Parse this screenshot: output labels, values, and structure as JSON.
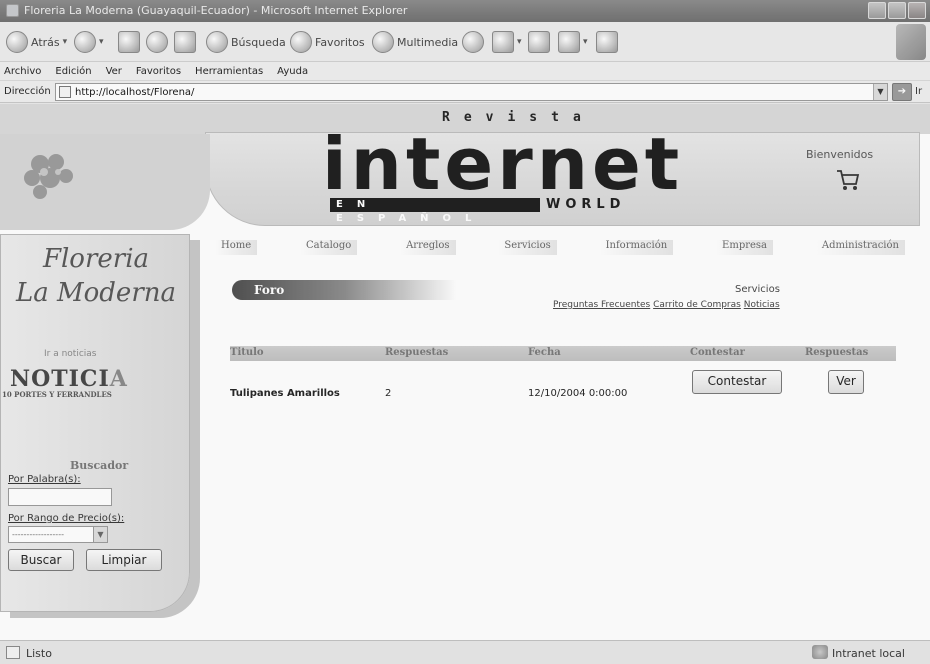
{
  "window": {
    "title": "Floreria La Moderna (Guayaquil-Ecuador) - Microsoft Internet Explorer"
  },
  "toolbar": {
    "back_label": "Atrás",
    "search_label": "Búsqueda",
    "favorites_label": "Favoritos",
    "media_label": "Multimedia"
  },
  "menu": [
    "Archivo",
    "Edición",
    "Ver",
    "Favoritos",
    "Herramientas",
    "Ayuda"
  ],
  "address": {
    "label": "Dirección",
    "url": "http://localhost/Florena/",
    "go_label": "Ir"
  },
  "header": {
    "magazine_top": "Revista",
    "magazine_main": "internet",
    "magazine_lang": "EN ESPAÑOL",
    "magazine_world": "WORLD",
    "welcome": "Bienvenidos"
  },
  "nav": [
    "Home",
    "Catalogo",
    "Arreglos",
    "Servicios",
    "Información",
    "Empresa",
    "Administración"
  ],
  "sidebar": {
    "title_line1": "Floreria",
    "title_line2": "La Moderna",
    "news_link": "Ir a noticias",
    "news_logo_big": "NOTICI",
    "news_logo_a": "A",
    "news_logo_small": "10 PORTES Y FERRANDLES",
    "search_title": "Buscador",
    "keyword_label": "Por Palabra(s):",
    "keyword_value": "",
    "price_label": "Por Rango de Precio(s):",
    "price_value": "------------------",
    "search_button": "Buscar",
    "clear_button": "Limpiar"
  },
  "page": {
    "section_title": "Foro",
    "services_title": "Servicios",
    "services_links": [
      "Preguntas Frecuentes",
      "Carrito de Compras",
      "Noticias"
    ]
  },
  "table": {
    "headers": [
      "Titulo",
      "Respuestas",
      "Fecha",
      "Contestar",
      "Respuestas"
    ],
    "rows": [
      {
        "title": "Tulipanes Amarillos",
        "answers": "2",
        "date": "12/10/2004 0:00:00",
        "reply_button": "Contestar",
        "view_button": "Ver"
      }
    ]
  },
  "status": {
    "text": "Listo",
    "zone": "Intranet local"
  }
}
